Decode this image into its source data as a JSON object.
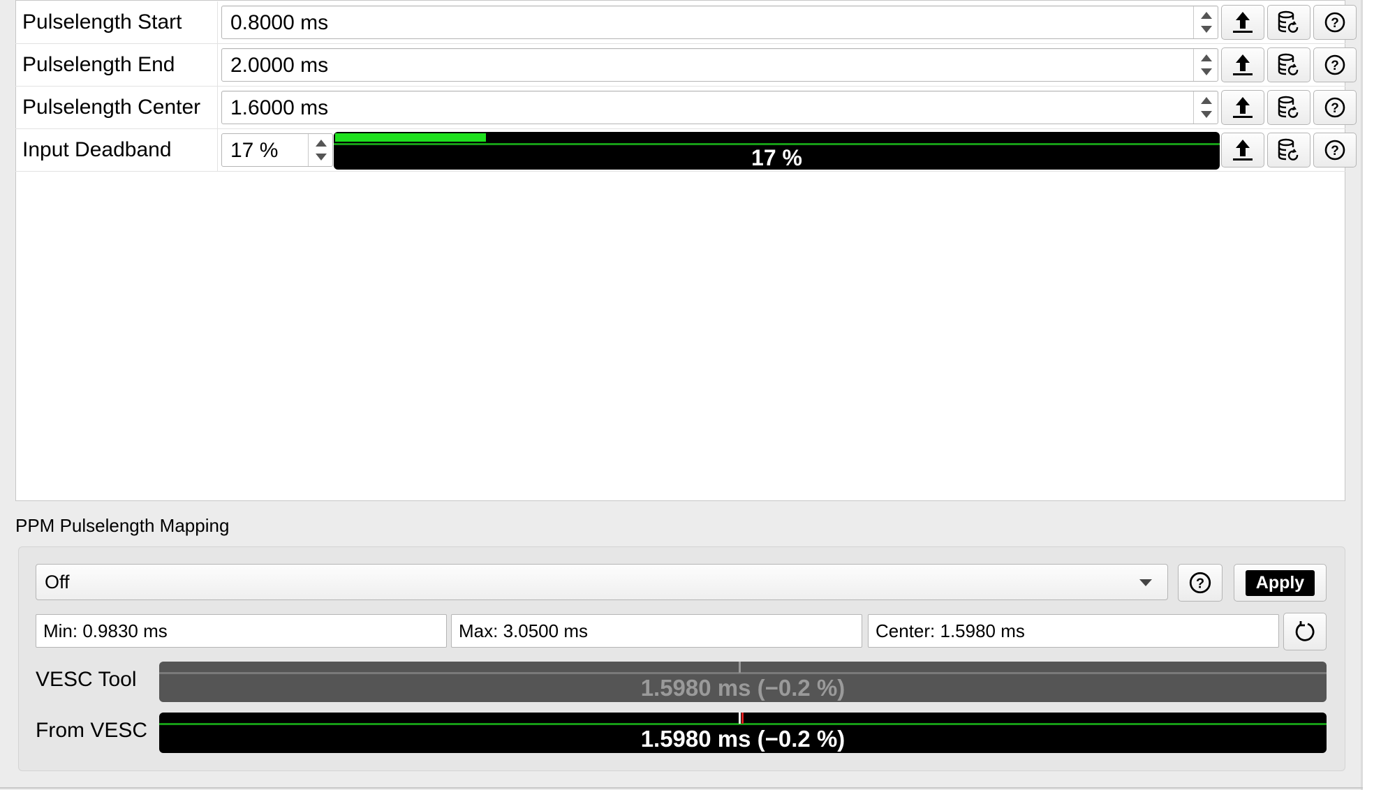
{
  "params": [
    {
      "label": "Pulselength Start",
      "value": "0.8000 ms"
    },
    {
      "label": "Pulselength End",
      "value": "2.0000 ms"
    },
    {
      "label": "Pulselength Center",
      "value": "1.6000 ms"
    }
  ],
  "deadband": {
    "label": "Input Deadband",
    "value": "17 %",
    "bar_text": "17 %",
    "bar_fraction": 0.17
  },
  "icons": {
    "write": "upload-arrow-icon",
    "read_default": "database-refresh-icon",
    "help": "help-circle-icon"
  },
  "mapping": {
    "title": "PPM Pulselength Mapping",
    "mode": "Off",
    "apply_label": "Apply",
    "min": "Min: 0.9830 ms",
    "max": "Max: 3.0500 ms",
    "center": "Center: 1.5980 ms",
    "vesc_tool_label": "VESC Tool",
    "vesc_tool_value": "1.5980 ms (−0.2 %)",
    "from_vesc_label": "From VESC",
    "from_vesc_value": "1.5980 ms (−0.2 %)"
  },
  "colors": {
    "bar_fill": "#1ee01e",
    "bar_line": "#169c16",
    "marker_red": "#e02020"
  }
}
